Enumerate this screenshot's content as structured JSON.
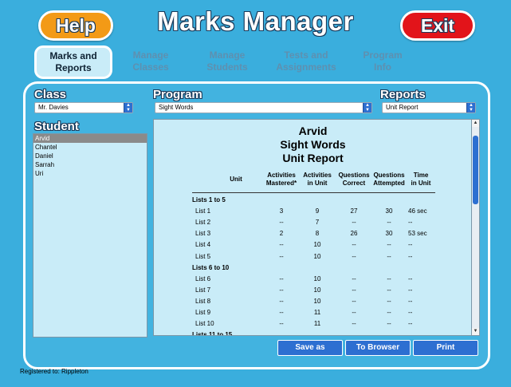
{
  "header": {
    "help_label": "Help",
    "title": "Marks Manager",
    "exit_label": "Exit"
  },
  "nav": {
    "tabs": [
      {
        "line1": "Marks and",
        "line2": "Reports",
        "state": "active"
      },
      {
        "line1": "Manage",
        "line2": "Classes",
        "state": "disabled"
      },
      {
        "line1": "Manage",
        "line2": "Students",
        "state": "disabled"
      },
      {
        "line1": "Tests and",
        "line2": "Assignments",
        "state": "disabled"
      },
      {
        "line1": "Program",
        "line2": "Info",
        "state": "disabled"
      }
    ]
  },
  "class_section": {
    "label": "Class",
    "selected": "Mr. Davies"
  },
  "program_section": {
    "label": "Program",
    "selected": "Sight Words"
  },
  "reports_section": {
    "label": "Reports",
    "selected": "Unit Report"
  },
  "student_section": {
    "label": "Student",
    "items": [
      "Arvid",
      "Chantel",
      "Daniel",
      "Sarrah",
      "Uri"
    ],
    "selected_index": 0
  },
  "report": {
    "student": "Arvid",
    "program": "Sight Words",
    "type": "Unit Report",
    "columns": {
      "unit": "Unit",
      "c1a": "Activities",
      "c1b": "Mastered*",
      "c2a": "Activities",
      "c2b": "in Unit",
      "c3a": "Questions",
      "c3b": "Correct",
      "c4a": "Questions",
      "c4b": "Attempted",
      "c5a": "Time",
      "c5b": "in Unit"
    },
    "rows": [
      {
        "group": true,
        "unit": "Lists 1 to 5"
      },
      {
        "unit": "List 1",
        "mastered": "3",
        "in_unit": "9",
        "correct": "27",
        "attempted": "30",
        "time": "46 sec"
      },
      {
        "unit": "List 2",
        "mastered": "--",
        "in_unit": "7",
        "correct": "--",
        "attempted": "--",
        "time": "--"
      },
      {
        "unit": "List 3",
        "mastered": "2",
        "in_unit": "8",
        "correct": "26",
        "attempted": "30",
        "time": "53 sec"
      },
      {
        "unit": "List 4",
        "mastered": "--",
        "in_unit": "10",
        "correct": "--",
        "attempted": "--",
        "time": "--"
      },
      {
        "unit": "List 5",
        "mastered": "--",
        "in_unit": "10",
        "correct": "--",
        "attempted": "--",
        "time": "--"
      },
      {
        "group": true,
        "unit": "Lists 6 to 10"
      },
      {
        "unit": "List 6",
        "mastered": "--",
        "in_unit": "10",
        "correct": "--",
        "attempted": "--",
        "time": "--"
      },
      {
        "unit": "List 7",
        "mastered": "--",
        "in_unit": "10",
        "correct": "--",
        "attempted": "--",
        "time": "--"
      },
      {
        "unit": "List 8",
        "mastered": "--",
        "in_unit": "10",
        "correct": "--",
        "attempted": "--",
        "time": "--"
      },
      {
        "unit": "List 9",
        "mastered": "--",
        "in_unit": "11",
        "correct": "--",
        "attempted": "--",
        "time": "--"
      },
      {
        "unit": "List 10",
        "mastered": "--",
        "in_unit": "11",
        "correct": "--",
        "attempted": "--",
        "time": "--"
      },
      {
        "group": true,
        "unit": "Lists 11 to 15"
      }
    ]
  },
  "actions": {
    "save_as": "Save as",
    "to_browser": "To Browser",
    "print": "Print"
  },
  "footer": {
    "registered": "Registered to: Rippleton"
  },
  "colors": {
    "background": "#3aaedd",
    "help": "#f39a16",
    "exit": "#e2141a",
    "button_blue": "#2d6fd1",
    "panel_fill": "#c9ecf8",
    "selected_student": "#8a8a8a"
  },
  "icons": {
    "select_arrow": "updown-arrow-icon",
    "scroll_up": "scroll-up-arrow-icon",
    "scroll_down": "scroll-down-arrow-icon"
  }
}
